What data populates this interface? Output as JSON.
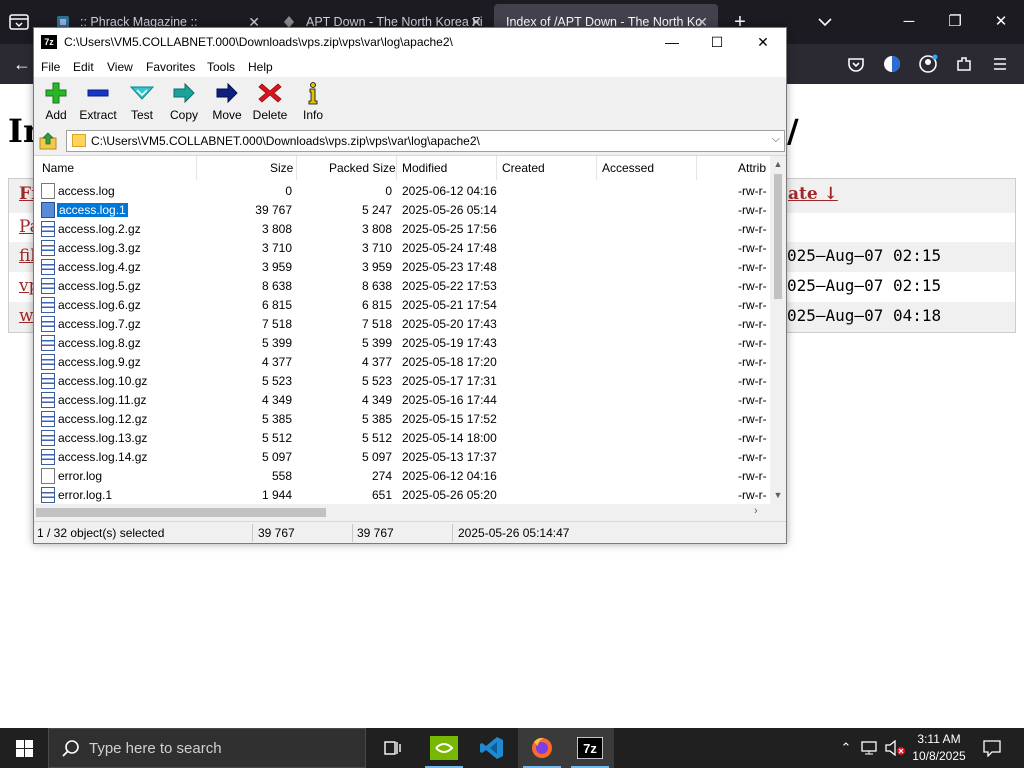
{
  "browser": {
    "tabs": [
      {
        "title": ":: Phrack Magazine ::",
        "active": false
      },
      {
        "title": "APT Down - The North Korea Fi",
        "active": false
      },
      {
        "title": "Index of /APT Down - The North Ko",
        "active": true
      }
    ],
    "new_tab": "+",
    "window_controls": {
      "minimize": "─",
      "restore": "❐",
      "close": "✕"
    },
    "back": "←"
  },
  "page": {
    "title_start": "In",
    "title_end": "/",
    "headers": [
      "Fi",
      "ate ↓"
    ],
    "rows": [
      {
        "name": "Pa",
        "date": ""
      },
      {
        "name": "fil",
        "date": "025–Aug–07 02:15"
      },
      {
        "name": "vp",
        "date": "025–Aug–07 02:15"
      },
      {
        "name": "wo",
        "date": "025–Aug–07 04:18"
      }
    ]
  },
  "sevenzip": {
    "icon_text": "7z",
    "title": "C:\\Users\\VM5.COLLABNET.000\\Downloads\\vps.zip\\vps\\var\\log\\apache2\\",
    "window_controls": {
      "minimize": "—",
      "maximize": "☐",
      "close": "✕"
    },
    "menu": [
      "File",
      "Edit",
      "View",
      "Favorites",
      "Tools",
      "Help"
    ],
    "toolbar": [
      {
        "label": "Add",
        "icon": "add-icon"
      },
      {
        "label": "Extract",
        "icon": "extract-icon"
      },
      {
        "label": "Test",
        "icon": "test-icon"
      },
      {
        "label": "Copy",
        "icon": "copy-icon"
      },
      {
        "label": "Move",
        "icon": "move-icon"
      },
      {
        "label": "Delete",
        "icon": "delete-icon"
      },
      {
        "label": "Info",
        "icon": "info-icon"
      }
    ],
    "address": "C:\\Users\\VM5.COLLABNET.000\\Downloads\\vps.zip\\vps\\var\\log\\apache2\\",
    "columns": [
      "Name",
      "Size",
      "Packed Size",
      "Modified",
      "Created",
      "Accessed",
      "Attrib"
    ],
    "files": [
      {
        "name": "access.log",
        "size": "0",
        "packed": "0",
        "modified": "2025-06-12 04:16",
        "attr": "-rw-r-",
        "type": "plain"
      },
      {
        "name": "access.log.1",
        "size": "39 767",
        "packed": "5 247",
        "modified": "2025-05-26 05:14",
        "attr": "-rw-r-",
        "type": "selected"
      },
      {
        "name": "access.log.2.gz",
        "size": "3 808",
        "packed": "3 808",
        "modified": "2025-05-25 17:56",
        "attr": "-rw-r-",
        "type": "gz"
      },
      {
        "name": "access.log.3.gz",
        "size": "3 710",
        "packed": "3 710",
        "modified": "2025-05-24 17:48",
        "attr": "-rw-r-",
        "type": "gz"
      },
      {
        "name": "access.log.4.gz",
        "size": "3 959",
        "packed": "3 959",
        "modified": "2025-05-23 17:48",
        "attr": "-rw-r-",
        "type": "gz"
      },
      {
        "name": "access.log.5.gz",
        "size": "8 638",
        "packed": "8 638",
        "modified": "2025-05-22 17:53",
        "attr": "-rw-r-",
        "type": "gz"
      },
      {
        "name": "access.log.6.gz",
        "size": "6 815",
        "packed": "6 815",
        "modified": "2025-05-21 17:54",
        "attr": "-rw-r-",
        "type": "gz"
      },
      {
        "name": "access.log.7.gz",
        "size": "7 518",
        "packed": "7 518",
        "modified": "2025-05-20 17:43",
        "attr": "-rw-r-",
        "type": "gz"
      },
      {
        "name": "access.log.8.gz",
        "size": "5 399",
        "packed": "5 399",
        "modified": "2025-05-19 17:43",
        "attr": "-rw-r-",
        "type": "gz"
      },
      {
        "name": "access.log.9.gz",
        "size": "4 377",
        "packed": "4 377",
        "modified": "2025-05-18 17:20",
        "attr": "-rw-r-",
        "type": "gz"
      },
      {
        "name": "access.log.10.gz",
        "size": "5 523",
        "packed": "5 523",
        "modified": "2025-05-17 17:31",
        "attr": "-rw-r-",
        "type": "gz"
      },
      {
        "name": "access.log.11.gz",
        "size": "4 349",
        "packed": "4 349",
        "modified": "2025-05-16 17:44",
        "attr": "-rw-r-",
        "type": "gz"
      },
      {
        "name": "access.log.12.gz",
        "size": "5 385",
        "packed": "5 385",
        "modified": "2025-05-15 17:52",
        "attr": "-rw-r-",
        "type": "gz"
      },
      {
        "name": "access.log.13.gz",
        "size": "5 512",
        "packed": "5 512",
        "modified": "2025-05-14 18:00",
        "attr": "-rw-r-",
        "type": "gz"
      },
      {
        "name": "access.log.14.gz",
        "size": "5 097",
        "packed": "5 097",
        "modified": "2025-05-13 17:37",
        "attr": "-rw-r-",
        "type": "gz"
      },
      {
        "name": "error.log",
        "size": "558",
        "packed": "274",
        "modified": "2025-06-12 04:16",
        "attr": "-rw-r-",
        "type": "plain"
      },
      {
        "name": "error.log.1",
        "size": "1 944",
        "packed": "651",
        "modified": "2025-05-26 05:20",
        "attr": "-rw-r-",
        "type": "gz"
      }
    ],
    "status": {
      "selection": "1 / 32 object(s) selected",
      "size": "39 767",
      "packed": "39 767",
      "modified": "2025-05-26 05:14:47"
    }
  },
  "taskbar": {
    "search_placeholder": "Type here to search",
    "time": "3:11 AM",
    "date": "10/8/2025"
  }
}
